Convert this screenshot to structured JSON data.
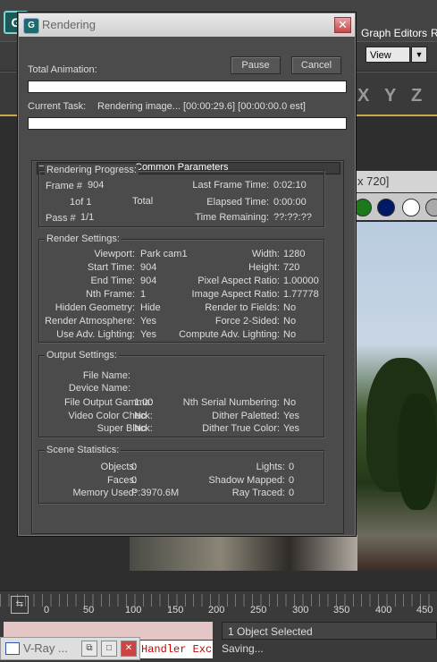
{
  "background": {
    "menu": {
      "graph_editors": "Graph Editors",
      "more": "R"
    },
    "view_select": "View",
    "axes": [
      "X",
      "Y",
      "Z"
    ],
    "vfb_title": "x 720]",
    "vfb_swatches": [
      "#1a7a1a",
      "#001a66",
      "#ffffff",
      "#aaaaaa"
    ],
    "timeline_ticks": [
      "0",
      "50",
      "100",
      "150",
      "200",
      "250",
      "300",
      "350",
      "400",
      "450"
    ],
    "maxscript_output": "Handler Exce",
    "status_selected": "1 Object Selected",
    "status_saving": "Saving...",
    "vray_min_title": "V-Ray ..."
  },
  "dialog": {
    "title": "Rendering",
    "total_animation_label": "Total Animation:",
    "pause_label": "Pause",
    "cancel_label": "Cancel",
    "current_task_label": "Current Task:",
    "current_task_value": "Rendering image... [00:00:29.6] [00:00:00.0 est]",
    "total_progress": 0,
    "task_progress": 0,
    "panel_title": "Common Parameters",
    "progress": {
      "title": "Rendering Progress:",
      "frame_label": "Frame #",
      "frame_value": "904",
      "of_value": "1of 1",
      "total_label": "Total",
      "pass_label": "Pass #",
      "pass_value": "1/1",
      "last_frame_time_label": "Last Frame Time:",
      "last_frame_time_value": "0:02:10",
      "elapsed_label": "Elapsed Time:",
      "elapsed_value": "0:00:00",
      "remaining_label": "Time Remaining:",
      "remaining_value": "??:??:??"
    },
    "render_settings": {
      "title": "Render Settings:",
      "left": [
        {
          "label": "Viewport:",
          "value": "Park cam1"
        },
        {
          "label": "Start Time:",
          "value": "904"
        },
        {
          "label": "End Time:",
          "value": "904"
        },
        {
          "label": "Nth Frame:",
          "value": "1"
        },
        {
          "label": "Hidden Geometry:",
          "value": "Hide"
        },
        {
          "label": "Render Atmosphere:",
          "value": "Yes"
        },
        {
          "label": "Use Adv. Lighting:",
          "value": "Yes"
        }
      ],
      "right": [
        {
          "label": "Width:",
          "value": "1280"
        },
        {
          "label": "Height:",
          "value": "720"
        },
        {
          "label": "Pixel Aspect Ratio:",
          "value": "1.00000"
        },
        {
          "label": "Image Aspect Ratio:",
          "value": "1.77778"
        },
        {
          "label": "Render to Fields:",
          "value": "No"
        },
        {
          "label": "Force 2-Sided:",
          "value": "No"
        },
        {
          "label": "Compute Adv. Lighting:",
          "value": "No"
        }
      ]
    },
    "output_settings": {
      "title": "Output Settings:",
      "file_name_label": "File Name:",
      "device_name_label": "Device Name:",
      "left": [
        {
          "label": "File Output Gamma:",
          "value": "1.00"
        },
        {
          "label": "Video Color Check:",
          "value": "No"
        },
        {
          "label": "Super Black:",
          "value": "No"
        }
      ],
      "right": [
        {
          "label": "Nth Serial Numbering:",
          "value": "No"
        },
        {
          "label": "Dither Paletted:",
          "value": "Yes"
        },
        {
          "label": "Dither True Color:",
          "value": "Yes"
        }
      ]
    },
    "scene_statistics": {
      "title": "Scene Statistics:",
      "left": [
        {
          "label": "Objects:",
          "value": "0"
        },
        {
          "label": "Faces:",
          "value": "0"
        },
        {
          "label": "Memory Used:",
          "value": "P:3970.6M"
        }
      ],
      "right": [
        {
          "label": "Lights:",
          "value": "0"
        },
        {
          "label": "Shadow Mapped:",
          "value": "0"
        },
        {
          "label": "Ray Traced:",
          "value": "0"
        }
      ]
    }
  }
}
